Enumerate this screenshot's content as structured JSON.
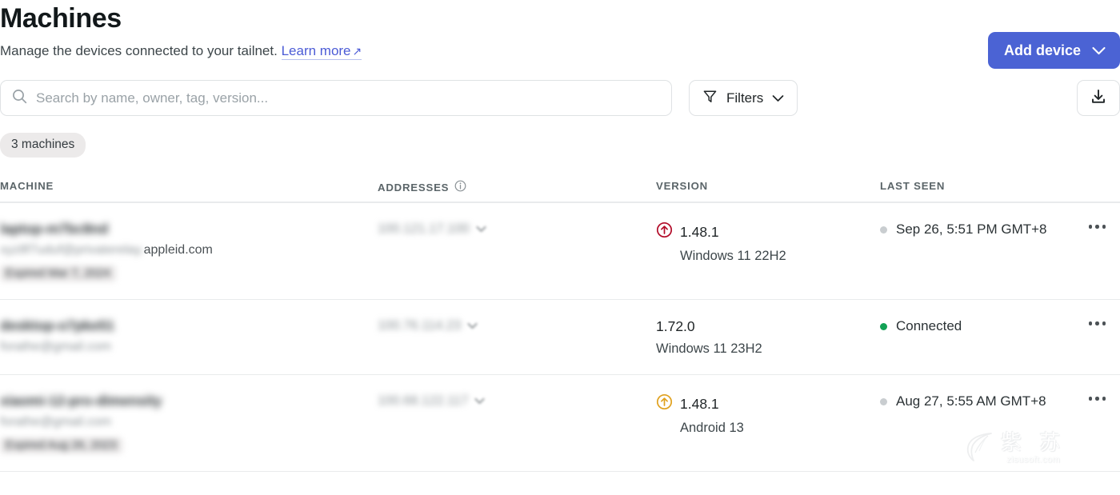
{
  "header": {
    "title": "Machines",
    "subtitle": "Manage the devices connected to your tailnet.",
    "learn_more": "Learn more",
    "external_arrow": "↗",
    "add_device_label": "Add device"
  },
  "toolbar": {
    "search_placeholder": "Search by name, owner, tag, version...",
    "search_value": "",
    "filters_label": "Filters",
    "download_icon": "download-icon",
    "filter_icon": "funnel-icon",
    "search_icon": "search-icon"
  },
  "count_badge": "3 machines",
  "table": {
    "columns": [
      {
        "label": "MACHINE",
        "has_info": false
      },
      {
        "label": "ADDRESSES",
        "has_info": true
      },
      {
        "label": "VERSION",
        "has_info": false
      },
      {
        "label": "LAST SEEN",
        "has_info": false
      }
    ],
    "rows": [
      {
        "name_redacted": "laptop-m7bc8nd",
        "owner_redacted": "xyz8f7uduf@privaterelay.",
        "owner_visible": "appleid.com",
        "expired_redacted": "Expired Mar 7, 2024",
        "has_expired": true,
        "address_redacted": "100.121.17.100",
        "version": "1.48.1",
        "update_available": true,
        "update_color": "#b20b28",
        "os": "Windows 11 22H2",
        "status_text": "Sep 26, 5:51 PM GMT+8",
        "status_color": "#c9cdd0"
      },
      {
        "name_redacted": "desktop-o7pke51",
        "owner_redacted": "forathe@gmail.com",
        "owner_visible": "",
        "expired_redacted": "",
        "has_expired": false,
        "address_redacted": "100.76.114.23",
        "version": "1.72.0",
        "update_available": false,
        "update_color": "",
        "os": "Windows 11 23H2",
        "status_text": "Connected",
        "status_color": "#12a155"
      },
      {
        "name_redacted": "xiaomi-12-pro-dimensity",
        "owner_redacted": "forathe@gmail.com",
        "owner_visible": "",
        "expired_redacted": "Expired Aug 26, 2023",
        "has_expired": true,
        "address_redacted": "100.68.122.117",
        "version": "1.48.1",
        "update_available": true,
        "update_color": "#e0a11e",
        "os": "Android 13",
        "status_text": "Aug 27, 5:55 AM GMT+8",
        "status_color": "#c9cdd0"
      }
    ]
  },
  "watermark": {
    "cn_text": "紫 苏",
    "url_text": "zisusoft.com",
    "icon": "leaf-icon"
  },
  "colors": {
    "accent": "#4b63d4",
    "link": "#4b5bd6",
    "connected": "#12a155",
    "update_critical": "#b20b28",
    "update_warning": "#e0a11e"
  }
}
